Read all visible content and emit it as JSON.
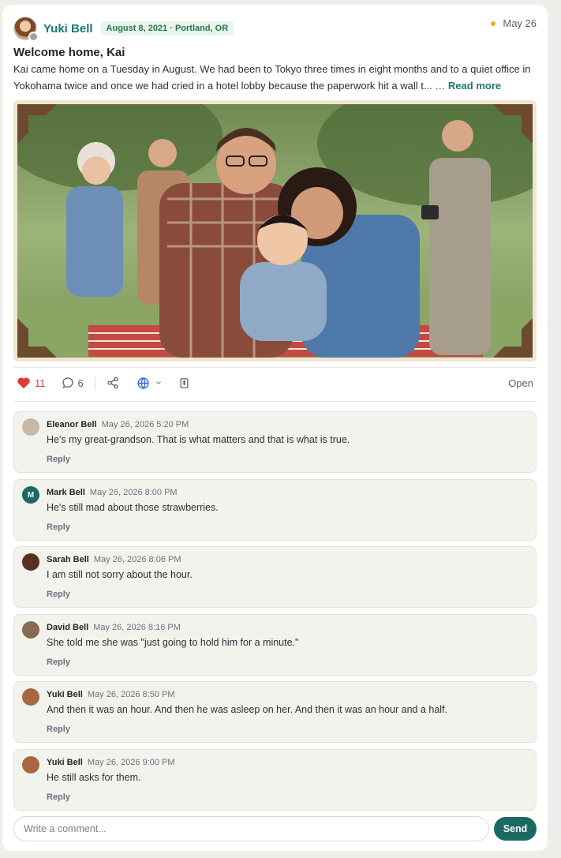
{
  "post": {
    "author": "Yuki Bell",
    "meta_badge": "August 8, 2021 · Portland, OR",
    "date": "May 26",
    "title": "Welcome home, Kai",
    "body": "Kai came home on a Tuesday in August. We had been to Tokyo three times in eight months and to a quiet office in Yokohama twice and once we had cried in a hotel lobby because the paperwork hit a wall t... ",
    "ellipsis": "…",
    "read_more": "Read more",
    "status_dot_color": "#e5b31a"
  },
  "actions": {
    "likes_count": "11",
    "comments_count": "6",
    "open_label": "Open",
    "icons": [
      "heart-icon",
      "comment-icon",
      "share-icon",
      "globe-icon",
      "chevron-down-icon",
      "notes-icon"
    ]
  },
  "comments": [
    {
      "name": "Eleanor Bell",
      "time": "May 26, 2026 5:20 PM",
      "text": "He's my great-grandson. That is what matters and that is what is true.",
      "reply": "Reply",
      "initial": "",
      "color": "#c9b8a6"
    },
    {
      "name": "Mark Bell",
      "time": "May 26, 2026 8:00 PM",
      "text": "He's still mad about those strawberries.",
      "reply": "Reply",
      "initial": "M",
      "color": "#1b6a62"
    },
    {
      "name": "Sarah Bell",
      "time": "May 26, 2026 8:06 PM",
      "text": "I am still not sorry about the hour.",
      "reply": "Reply",
      "initial": "",
      "color": "#5a2e24"
    },
    {
      "name": "David Bell",
      "time": "May 26, 2026 8:16 PM",
      "text": "She told me she was \"just going to hold him for a minute.\"",
      "reply": "Reply",
      "initial": "",
      "color": "#8a6a52"
    },
    {
      "name": "Yuki Bell",
      "time": "May 26, 2026 8:50 PM",
      "text": "And then it was an hour. And then he was asleep on her. And then it was an hour and a half.",
      "reply": "Reply",
      "initial": "",
      "color": "#a8683e"
    },
    {
      "name": "Yuki Bell",
      "time": "May 26, 2026 9:00 PM",
      "text": "He still asks for them.",
      "reply": "Reply",
      "initial": "",
      "color": "#a8683e"
    }
  ],
  "composer": {
    "placeholder": "Write a comment...",
    "send_label": "Send"
  }
}
